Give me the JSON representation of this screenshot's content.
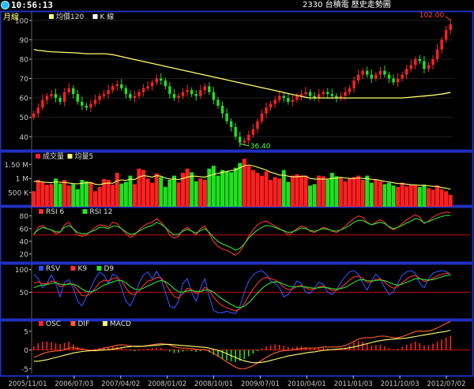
{
  "header": {
    "time": "10:56:13",
    "title": "2330 台積電 歷史走勢圖"
  },
  "colors": {
    "up": "#ff2020",
    "down": "#20e020",
    "ma": "#ffff70",
    "panel_border": "#2030c0",
    "grid": "#c01010",
    "axis_text": "#c8c8c8",
    "k_line": "#ff3030",
    "d_line": "#30e030",
    "rsv_line": "#3050ff",
    "osc": "#ff2020",
    "dif": "#ff6030",
    "macd": "#ffff70",
    "label_green": "#50ff50",
    "label_red": "#ff4040"
  },
  "chart_data": [
    {
      "type": "candlestick",
      "period_label": "月線",
      "legend": [
        "均價120",
        "K 線"
      ],
      "ylim": [
        34,
        104
      ],
      "yticks": [
        40,
        50,
        60,
        70,
        80,
        90,
        100
      ],
      "x": [
        "2005/11/01",
        "2006/07/03",
        "2007/04/02",
        "2008/01/02",
        "2008/10/01",
        "2009/07/01",
        "2010/04/01",
        "2011/01/03",
        "2011/10/03",
        "2012/07/02"
      ],
      "close": [
        52,
        55,
        59,
        61,
        62,
        60,
        58,
        63,
        65,
        62,
        58,
        56,
        55,
        57,
        59,
        61,
        62,
        64,
        66,
        67,
        65,
        62,
        60,
        61,
        63,
        65,
        66,
        68,
        70,
        69,
        66,
        62,
        60,
        61,
        63,
        64,
        62,
        61,
        64,
        66,
        63,
        59,
        56,
        52,
        48,
        45,
        40,
        37,
        38,
        41,
        44,
        48,
        52,
        55,
        57,
        59,
        61,
        60,
        58,
        59,
        61,
        62,
        63,
        61,
        60,
        62,
        63,
        62,
        61,
        60,
        61,
        63,
        65,
        69,
        72,
        74,
        72,
        70,
        72,
        74,
        72,
        70,
        68,
        70,
        72,
        75,
        77,
        80,
        79,
        75,
        77,
        80,
        85,
        90,
        95,
        98
      ],
      "ma": [
        85,
        84.5,
        84.3,
        84,
        83.8,
        83.7,
        83.6,
        83.5,
        83.4,
        83.3,
        83.2,
        83,
        82.8,
        82.8,
        82.8,
        82.8,
        82.8,
        82.6,
        82.3,
        81.8,
        81.3,
        80.8,
        80.3,
        79.8,
        79.3,
        78.8,
        78.3,
        77.8,
        77.3,
        76.8,
        76.3,
        75.8,
        75.3,
        74.8,
        74.3,
        73.8,
        73.3,
        72.8,
        72.3,
        71.8,
        71.3,
        70.8,
        70.3,
        69.8,
        69.3,
        68.8,
        68.3,
        67.8,
        67.3,
        66.8,
        66.3,
        65.8,
        65.3,
        64.8,
        64.3,
        63.8,
        63.3,
        62.8,
        62.3,
        61.8,
        61.3,
        60.8,
        60.3,
        60,
        60,
        60,
        60,
        60,
        60,
        60,
        60,
        60,
        60,
        60,
        60,
        60,
        60,
        60,
        60,
        60,
        60,
        60,
        60,
        60,
        60,
        60.2,
        60.4,
        60.6,
        60.8,
        61,
        61.2,
        61.4,
        61.7,
        62,
        62.4,
        62.8
      ],
      "annotations": [
        {
          "text": "36.40",
          "value": 36.4
        },
        {
          "text": "102.00",
          "value": 102.0
        }
      ]
    },
    {
      "type": "bar",
      "legend": [
        "成交量",
        "均量5"
      ],
      "ylim": [
        0,
        1.9
      ],
      "ytick_labels": [
        "1.50 M",
        "1 M",
        "500 K"
      ],
      "yticks": [
        1.5,
        1.0,
        0.5
      ],
      "values": [
        0.55,
        0.95,
        0.88,
        0.78,
        0.8,
        1.0,
        0.82,
        0.95,
        0.75,
        0.8,
        0.62,
        0.95,
        0.9,
        0.88,
        0.55,
        0.7,
        0.98,
        0.95,
        0.78,
        1.2,
        0.82,
        0.88,
        1.1,
        0.8,
        1.35,
        1.3,
        1.0,
        0.85,
        1.18,
        1.05,
        0.7,
        0.95,
        1.1,
        0.86,
        1.2,
        1.35,
        1.22,
        0.9,
        1.0,
        0.95,
        1.35,
        1.45,
        1.1,
        1.3,
        1.25,
        1.22,
        1.38,
        1.55,
        1.7,
        1.45,
        1.3,
        1.2,
        1.1,
        1.25,
        0.95,
        1.05,
        1.0,
        1.3,
        0.88,
        1.1,
        1.15,
        1.1,
        1.1,
        0.75,
        0.8,
        1.1,
        1.08,
        0.96,
        1.2,
        1.08,
        1.05,
        0.9,
        1.0,
        1.05,
        1.1,
        0.95,
        1.1,
        0.85,
        0.95,
        0.9,
        0.8,
        0.85,
        0.75,
        0.7,
        0.85,
        0.72,
        0.78,
        0.78,
        0.7,
        0.78,
        0.66,
        0.6,
        0.75,
        0.62,
        0.55,
        0.42
      ],
      "ma5": [
        0.9,
        0.9,
        0.88,
        0.86,
        0.85,
        0.88,
        0.87,
        0.86,
        0.84,
        0.82,
        0.81,
        0.83,
        0.85,
        0.85,
        0.8,
        0.78,
        0.82,
        0.84,
        0.83,
        0.92,
        0.95,
        0.93,
        0.98,
        0.96,
        1.05,
        1.1,
        1.08,
        1.05,
        1.1,
        1.08,
        1.02,
        0.98,
        0.98,
        0.96,
        1.0,
        1.05,
        1.08,
        1.08,
        1.06,
        1.05,
        1.1,
        1.15,
        1.18,
        1.22,
        1.25,
        1.28,
        1.3,
        1.38,
        1.45,
        1.48,
        1.45,
        1.4,
        1.35,
        1.3,
        1.22,
        1.18,
        1.12,
        1.12,
        1.08,
        1.06,
        1.06,
        1.08,
        1.08,
        1.0,
        0.98,
        0.98,
        0.98,
        0.98,
        1.0,
        1.02,
        1.04,
        1.02,
        1.0,
        1.0,
        1.02,
        1.0,
        1.0,
        0.97,
        0.96,
        0.93,
        0.9,
        0.88,
        0.85,
        0.82,
        0.82,
        0.8,
        0.78,
        0.77,
        0.76,
        0.76,
        0.74,
        0.72,
        0.72,
        0.68,
        0.66,
        0.62
      ]
    },
    {
      "type": "line",
      "legend": [
        "RSI 6",
        "RSI 12"
      ],
      "ylim": [
        10,
        92
      ],
      "yticks": [
        80,
        60,
        40,
        20
      ],
      "reference_line": 50,
      "series": [
        {
          "name": "RSI 6",
          "values": [
            50,
            62,
            65,
            60,
            58,
            52,
            54,
            66,
            70,
            60,
            50,
            48,
            50,
            56,
            62,
            66,
            65,
            62,
            70,
            68,
            60,
            52,
            46,
            50,
            58,
            64,
            68,
            70,
            76,
            70,
            62,
            50,
            45,
            48,
            58,
            62,
            56,
            50,
            60,
            64,
            52,
            40,
            32,
            28,
            26,
            22,
            18,
            24,
            35,
            48,
            58,
            66,
            70,
            72,
            68,
            64,
            60,
            56,
            50,
            54,
            60,
            64,
            62,
            56,
            54,
            58,
            62,
            60,
            56,
            54,
            58,
            64,
            70,
            76,
            80,
            78,
            70,
            66,
            70,
            74,
            70,
            62,
            58,
            62,
            68,
            74,
            78,
            82,
            78,
            68,
            72,
            78,
            82,
            84,
            86,
            85
          ]
        },
        {
          "name": "RSI 12",
          "values": [
            52,
            58,
            62,
            60,
            58,
            55,
            55,
            62,
            65,
            60,
            54,
            52,
            52,
            55,
            58,
            62,
            62,
            60,
            64,
            64,
            60,
            55,
            51,
            52,
            56,
            60,
            63,
            65,
            70,
            67,
            62,
            55,
            50,
            51,
            56,
            59,
            56,
            53,
            57,
            60,
            54,
            46,
            40,
            36,
            33,
            30,
            26,
            29,
            36,
            45,
            52,
            58,
            62,
            65,
            64,
            62,
            59,
            57,
            54,
            55,
            58,
            61,
            60,
            57,
            56,
            58,
            60,
            59,
            57,
            56,
            58,
            61,
            65,
            70,
            73,
            73,
            69,
            66,
            68,
            70,
            68,
            63,
            60,
            62,
            65,
            69,
            72,
            76,
            74,
            69,
            71,
            74,
            77,
            79,
            81,
            81
          ]
        }
      ]
    },
    {
      "type": "line",
      "legend": [
        "RSV",
        "K9",
        "D9"
      ],
      "ylim": [
        -5,
        110
      ],
      "yticks": [
        100,
        50
      ],
      "reference_line": 50,
      "series": [
        {
          "name": "RSV",
          "values": [
            90,
            80,
            60,
            70,
            88,
            70,
            40,
            72,
            78,
            60,
            30,
            20,
            40,
            60,
            80,
            95,
            88,
            70,
            90,
            85,
            60,
            30,
            20,
            40,
            70,
            88,
            95,
            80,
            96,
            80,
            50,
            20,
            15,
            30,
            70,
            80,
            50,
            30,
            60,
            80,
            40,
            10,
            5,
            5,
            8,
            5,
            3,
            20,
            50,
            75,
            88,
            95,
            98,
            90,
            75,
            70,
            60,
            40,
            45,
            60,
            75,
            70,
            50,
            48,
            60,
            72,
            68,
            50,
            45,
            55,
            72,
            85,
            95,
            98,
            90,
            70,
            55,
            75,
            90,
            80,
            60,
            45,
            50,
            70,
            88,
            95,
            98,
            92,
            70,
            60,
            80,
            92,
            96,
            98,
            96,
            90
          ]
        },
        {
          "name": "K9",
          "values": [
            70,
            73,
            69,
            69,
            75,
            73,
            62,
            65,
            70,
            67,
            55,
            43,
            42,
            48,
            59,
            71,
            77,
            75,
            80,
            82,
            75,
            60,
            47,
            45,
            53,
            65,
            75,
            77,
            83,
            82,
            71,
            54,
            41,
            37,
            48,
            59,
            56,
            47,
            51,
            61,
            54,
            39,
            28,
            20,
            16,
            12,
            9,
            13,
            25,
            42,
            57,
            70,
            79,
            83,
            80,
            77,
            71,
            61,
            56,
            57,
            63,
            65,
            60,
            56,
            57,
            62,
            64,
            59,
            54,
            54,
            60,
            68,
            77,
            84,
            86,
            81,
            72,
            73,
            79,
            79,
            73,
            64,
            59,
            63,
            71,
            79,
            85,
            87,
            81,
            74,
            76,
            81,
            86,
            90,
            92,
            91
          ]
        },
        {
          "name": "D9",
          "values": [
            60,
            64,
            66,
            67,
            70,
            71,
            68,
            67,
            68,
            68,
            64,
            57,
            52,
            51,
            54,
            60,
            66,
            69,
            73,
            76,
            76,
            71,
            63,
            57,
            56,
            59,
            64,
            68,
            73,
            76,
            74,
            67,
            58,
            51,
            50,
            53,
            54,
            52,
            52,
            55,
            55,
            50,
            42,
            35,
            29,
            23,
            18,
            16,
            19,
            27,
            37,
            48,
            58,
            66,
            71,
            73,
            72,
            68,
            64,
            62,
            62,
            63,
            62,
            60,
            59,
            60,
            61,
            60,
            58,
            57,
            58,
            61,
            66,
            72,
            77,
            78,
            76,
            75,
            76,
            77,
            76,
            72,
            68,
            66,
            68,
            72,
            76,
            80,
            80,
            78,
            77,
            78,
            81,
            84,
            87,
            88
          ]
        }
      ]
    },
    {
      "type": "bar",
      "legend": [
        "OSC",
        "DIF",
        "MACD"
      ],
      "ylim": [
        -6,
        7.5
      ],
      "yticks": [
        5,
        0,
        -5
      ],
      "osc": [
        1.0,
        1.8,
        2.2,
        2.3,
        2.1,
        1.8,
        1.6,
        1.9,
        2.2,
        1.5,
        0.9,
        0.5,
        0.2,
        0.1,
        0.3,
        0.5,
        0.8,
        0.6,
        0.9,
        1.0,
        0.6,
        0.2,
        -0.2,
        -0.3,
        -0.1,
        0.2,
        0.4,
        0.5,
        0.6,
        0.5,
        0.1,
        -0.4,
        -0.8,
        -0.7,
        -0.4,
        -0.1,
        -0.3,
        -0.5,
        -0.3,
        0,
        -0.6,
        -1.3,
        -1.9,
        -2.4,
        -2.8,
        -3.0,
        -3.2,
        -2.9,
        -2.4,
        -1.7,
        -1.0,
        -0.3,
        0.4,
        0.9,
        1.3,
        1.5,
        1.4,
        1.1,
        0.8,
        0.7,
        0.9,
        1.0,
        0.8,
        0.5,
        0.4,
        0.5,
        0.6,
        0.4,
        0.2,
        0.1,
        0.3,
        0.7,
        1.3,
        2.0,
        2.4,
        2.2,
        1.6,
        1.2,
        1.3,
        1.4,
        1.0,
        0.5,
        0.2,
        0.4,
        0.9,
        1.4,
        1.8,
        2.2,
        1.8,
        1.2,
        1.3,
        1.7,
        2.2,
        2.8,
        3.4,
        3.8
      ],
      "dif": [
        -2.0,
        -1.5,
        -1.0,
        -0.6,
        -0.4,
        -0.3,
        -0.2,
        0.1,
        0.5,
        0.6,
        0.4,
        0.2,
        0,
        -0.1,
        0,
        0.2,
        0.5,
        0.7,
        1.0,
        1.3,
        1.4,
        1.3,
        1.1,
        0.9,
        0.9,
        1.0,
        1.2,
        1.4,
        1.6,
        1.7,
        1.6,
        1.3,
        0.9,
        0.6,
        0.5,
        0.5,
        0.4,
        0.2,
        0.1,
        0.1,
        -0.3,
        -0.9,
        -1.6,
        -2.4,
        -3.2,
        -3.9,
        -4.6,
        -5.0,
        -5.0,
        -4.7,
        -4.2,
        -3.5,
        -2.7,
        -2.0,
        -1.3,
        -0.8,
        -0.4,
        -0.2,
        -0.1,
        0,
        0.2,
        0.4,
        0.5,
        0.5,
        0.5,
        0.6,
        0.8,
        0.8,
        0.8,
        0.8,
        0.9,
        1.2,
        1.7,
        2.3,
        2.9,
        3.2,
        3.3,
        3.3,
        3.5,
        3.7,
        3.7,
        3.5,
        3.3,
        3.3,
        3.6,
        4.0,
        4.5,
        5.0,
        5.1,
        5.0,
        5.1,
        5.4,
        5.9,
        6.5,
        7.1,
        7.6
      ],
      "macd": [
        -3.0,
        -3.0,
        -2.8,
        -2.6,
        -2.3,
        -2.0,
        -1.7,
        -1.4,
        -1.1,
        -0.8,
        -0.6,
        -0.4,
        -0.3,
        -0.2,
        -0.2,
        -0.1,
        0,
        0.1,
        0.2,
        0.4,
        0.6,
        0.8,
        0.9,
        1.0,
        1.0,
        1.0,
        1.1,
        1.2,
        1.3,
        1.4,
        1.5,
        1.5,
        1.4,
        1.3,
        1.2,
        1.1,
        1.0,
        0.9,
        0.8,
        0.7,
        0.5,
        0.2,
        -0.1,
        -0.5,
        -1.0,
        -1.5,
        -2.0,
        -2.5,
        -2.9,
        -3.2,
        -3.4,
        -3.4,
        -3.3,
        -3.1,
        -2.8,
        -2.5,
        -2.2,
        -1.9,
        -1.6,
        -1.4,
        -1.2,
        -1.0,
        -0.8,
        -0.6,
        -0.5,
        -0.3,
        -0.1,
        0,
        0.1,
        0.2,
        0.3,
        0.4,
        0.6,
        0.8,
        1.1,
        1.4,
        1.7,
        2.0,
        2.3,
        2.5,
        2.7,
        2.8,
        2.9,
        3.0,
        3.1,
        3.2,
        3.4,
        3.6,
        3.8,
        4.0,
        4.2,
        4.4,
        4.6,
        4.8,
        5.0,
        5.3
      ]
    }
  ]
}
